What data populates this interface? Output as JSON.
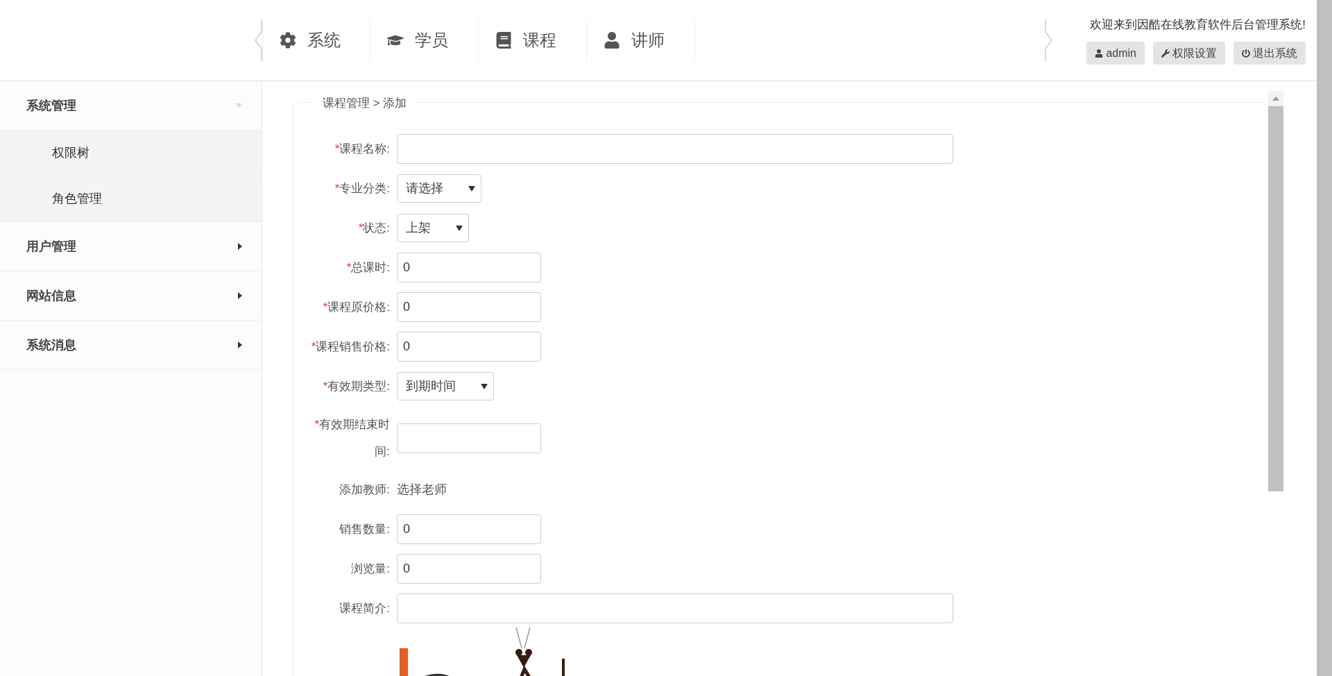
{
  "header": {
    "nav": [
      {
        "label": "系统"
      },
      {
        "label": "学员"
      },
      {
        "label": "课程"
      },
      {
        "label": "讲师"
      }
    ],
    "welcome": "欢迎来到因酷在线教育软件后台管理系统!",
    "buttons": [
      {
        "label": "admin"
      },
      {
        "label": "权限设置"
      },
      {
        "label": "退出系统"
      }
    ]
  },
  "sidebar": {
    "groups": [
      {
        "label": "系统管理",
        "expanded": true,
        "children": [
          {
            "label": "权限树"
          },
          {
            "label": "角色管理"
          }
        ]
      },
      {
        "label": "用户管理",
        "expanded": false
      },
      {
        "label": "网站信息",
        "expanded": false
      },
      {
        "label": "系统消息",
        "expanded": false
      }
    ]
  },
  "breadcrumb": "课程管理 > 添加",
  "form": {
    "fields": [
      {
        "mark": "*",
        "label": "课程名称:",
        "kind": "longtext"
      },
      {
        "mark": "*",
        "label": "专业分类:",
        "kind": "select",
        "value": "请选择"
      },
      {
        "mark": "*",
        "label": "状态:",
        "kind": "select",
        "value": "上架"
      },
      {
        "mark": "*",
        "label": "总课时:",
        "kind": "text",
        "value": "0"
      },
      {
        "mark": "*",
        "label": "课程原价格:",
        "kind": "text",
        "value": "0"
      },
      {
        "mark": "*",
        "label": "课程销售价格:",
        "kind": "text",
        "value": "0"
      },
      {
        "mark": "*",
        "label": "有效期类型:",
        "kind": "select",
        "value": "到期时间"
      },
      {
        "mark": "*",
        "label": "有效期结束时间:",
        "kind": "text"
      },
      {
        "label": "添加教师:",
        "kind": "link",
        "value": "选择老师"
      },
      {
        "label": "销售数量:",
        "kind": "text",
        "value": "0"
      },
      {
        "label": "浏览量:",
        "kind": "text",
        "value": "0"
      },
      {
        "label": "课程简介:",
        "kind": "longtext"
      }
    ]
  }
}
